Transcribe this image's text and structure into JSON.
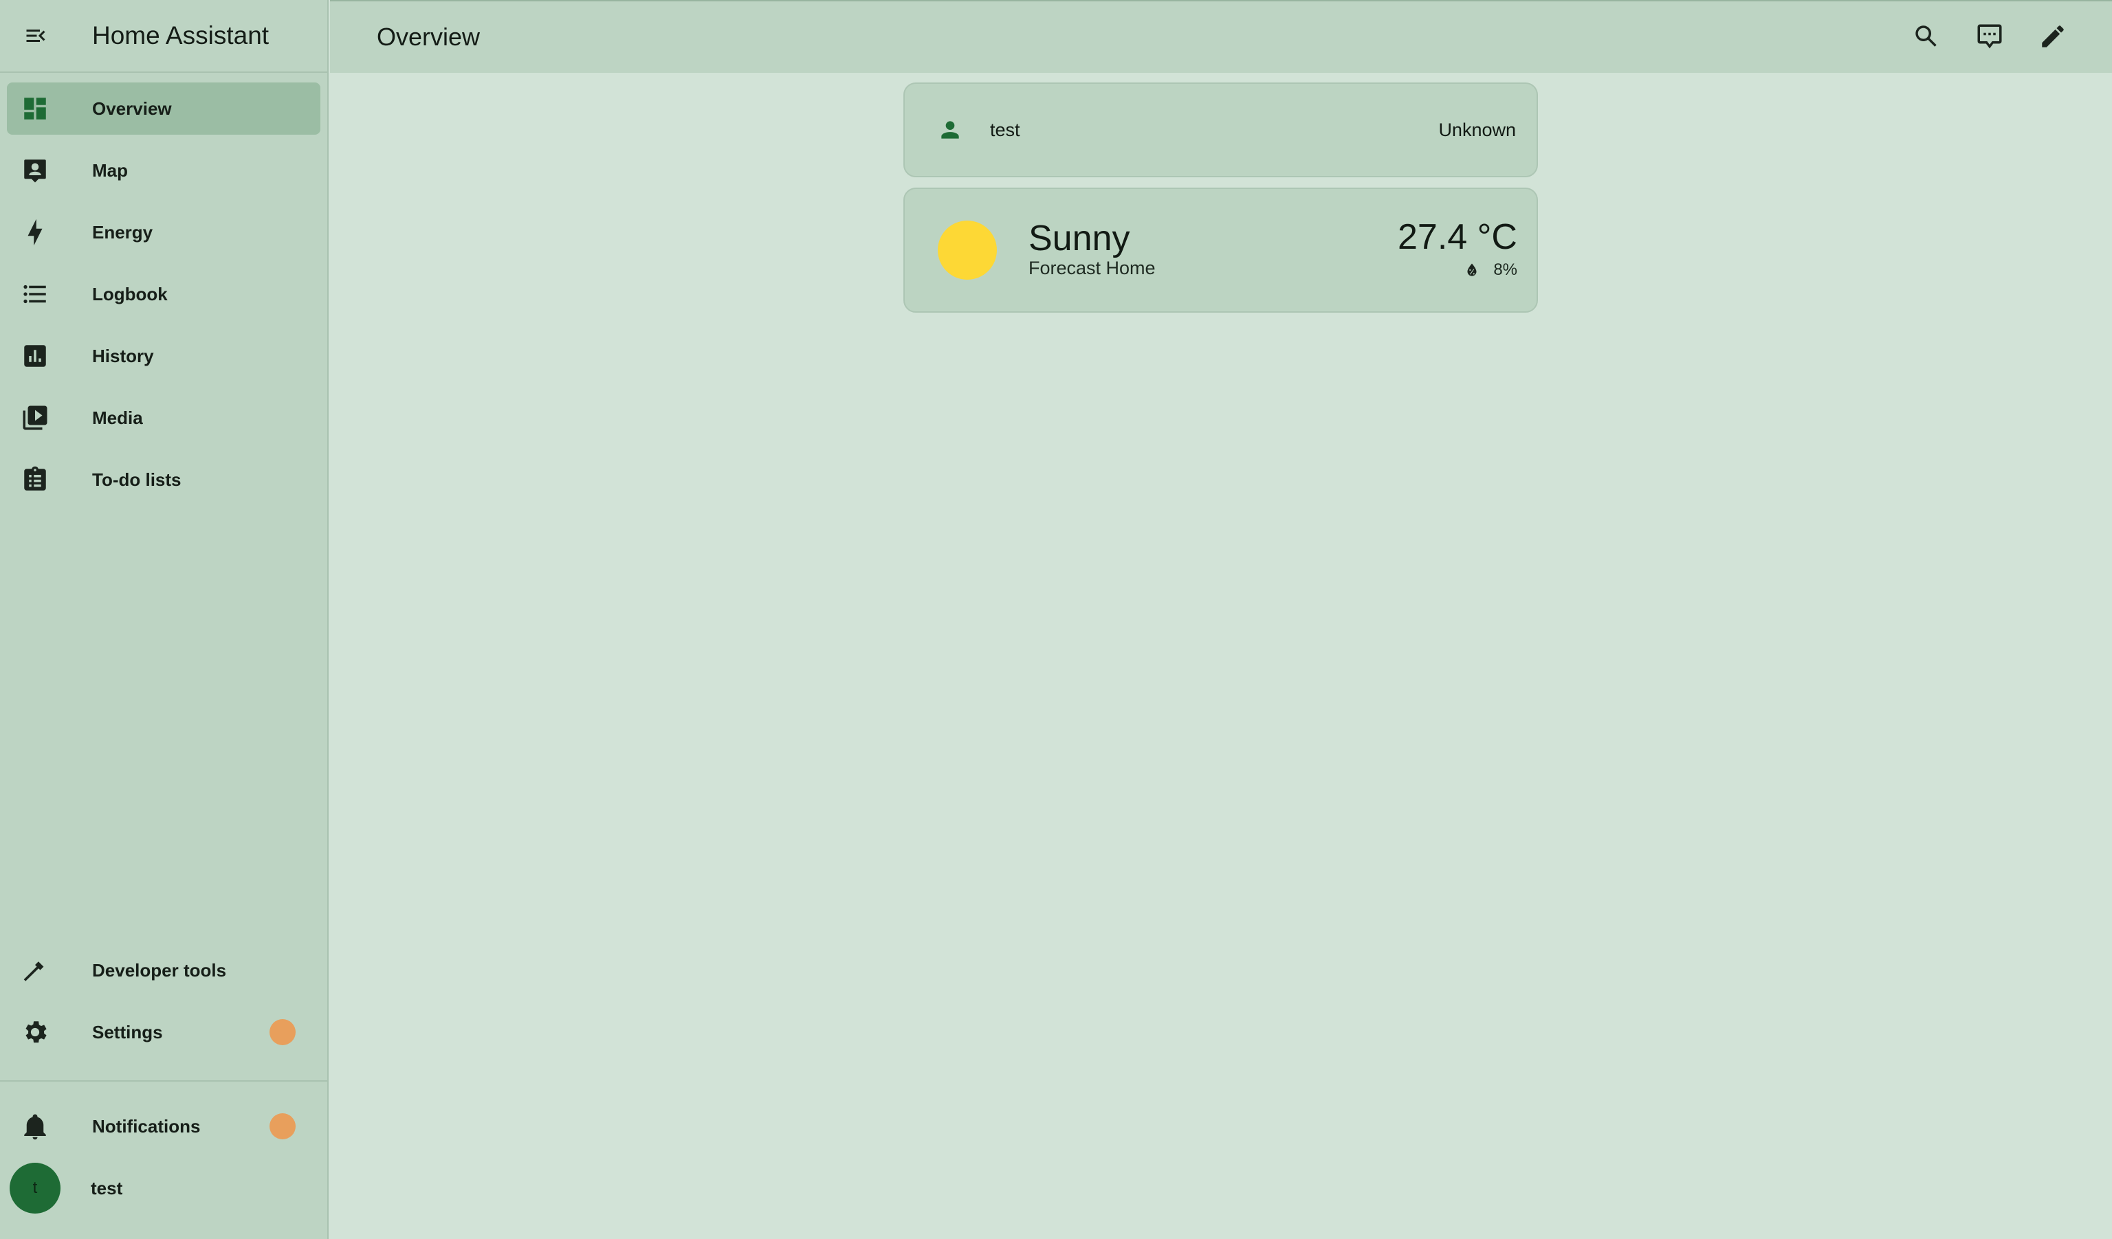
{
  "app": {
    "title": "Home Assistant",
    "accent_color": "#1e6b35",
    "badge_color": "#e89f5c"
  },
  "sidebar": {
    "items": [
      {
        "label": "Overview",
        "icon": "view-dashboard-icon",
        "active": true
      },
      {
        "label": "Map",
        "icon": "map-account-icon"
      },
      {
        "label": "Energy",
        "icon": "lightning-bolt-icon"
      },
      {
        "label": "Logbook",
        "icon": "format-list-bulleted-icon"
      },
      {
        "label": "History",
        "icon": "chart-box-icon"
      },
      {
        "label": "Media",
        "icon": "play-box-multiple-icon"
      },
      {
        "label": "To-do lists",
        "icon": "clipboard-list-icon"
      }
    ],
    "bottom_items": [
      {
        "label": "Developer tools",
        "icon": "hammer-icon"
      },
      {
        "label": "Settings",
        "icon": "cog-icon",
        "badge": true
      }
    ],
    "notifications": {
      "label": "Notifications",
      "icon": "bell-icon",
      "badge": true
    },
    "user": {
      "label": "test",
      "avatar_initial": "t"
    }
  },
  "header": {
    "title": "Overview",
    "actions": [
      "search-icon",
      "assist-icon",
      "pencil-icon"
    ]
  },
  "cards": {
    "person": {
      "name": "test",
      "state": "Unknown",
      "icon": "account-icon"
    },
    "weather": {
      "condition": "Sunny",
      "name": "Forecast Home",
      "temperature": "27.4 °C",
      "precipitation": "8%",
      "icon": "sunny-icon"
    }
  }
}
